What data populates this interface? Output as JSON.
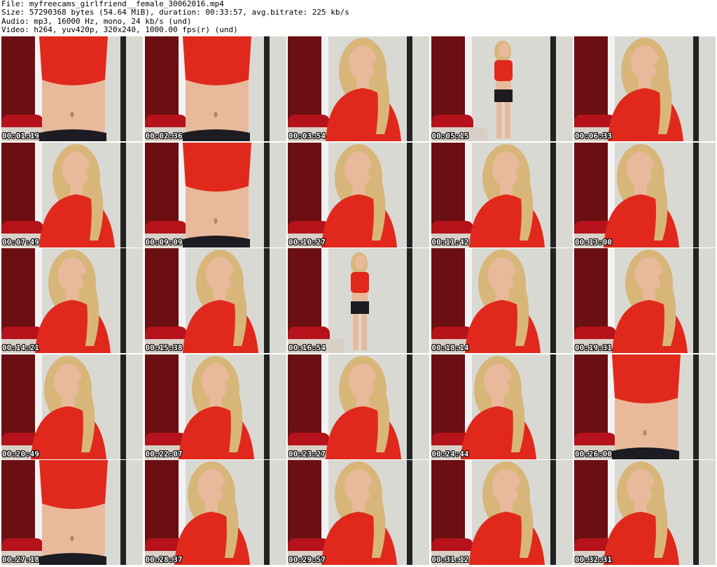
{
  "header": {
    "file_line": "File: myfreecams_girlfriend__female_30062016.mp4",
    "size_line": "Size: 57290368 bytes (54.64 MiB), duration: 00:33:57, avg.bitrate: 225 kb/s",
    "audio_line": "Audio: mp3, 16000 Hz, mono, 24 kb/s (und)",
    "video_line": "Video: h264, yuv420p, 320x240, 1000.00 fps(r) (und)"
  },
  "colors": {
    "top_red": "#e0291c",
    "wall": "#d9d9d4",
    "curtain": "#6b0f12",
    "hair": "#d8b67a",
    "skin": "#e8b99a",
    "shorts": "#1c1c22",
    "chair": "#b5121b",
    "floor": "#d8cfc6"
  },
  "thumbnails": [
    {
      "timestamp": "00:01:19",
      "scene": "torso"
    },
    {
      "timestamp": "00:02:36",
      "scene": "torso"
    },
    {
      "timestamp": "00:03:54",
      "scene": "portrait"
    },
    {
      "timestamp": "00:05:15",
      "scene": "standing"
    },
    {
      "timestamp": "00:06:33",
      "scene": "portrait"
    },
    {
      "timestamp": "00:07:49",
      "scene": "portrait"
    },
    {
      "timestamp": "00:09:09",
      "scene": "torso"
    },
    {
      "timestamp": "00:10:27",
      "scene": "portrait"
    },
    {
      "timestamp": "00:11:42",
      "scene": "portrait"
    },
    {
      "timestamp": "00:13:00",
      "scene": "portrait"
    },
    {
      "timestamp": "00:14:21",
      "scene": "portrait"
    },
    {
      "timestamp": "00:15:38",
      "scene": "portrait"
    },
    {
      "timestamp": "00:16:54",
      "scene": "standing"
    },
    {
      "timestamp": "00:18:14",
      "scene": "portrait"
    },
    {
      "timestamp": "00:19:31",
      "scene": "portrait"
    },
    {
      "timestamp": "00:20:49",
      "scene": "portrait"
    },
    {
      "timestamp": "00:22:07",
      "scene": "portrait"
    },
    {
      "timestamp": "00:23:27",
      "scene": "portrait"
    },
    {
      "timestamp": "00:24:44",
      "scene": "portrait"
    },
    {
      "timestamp": "00:26:00",
      "scene": "torso"
    },
    {
      "timestamp": "00:27:18",
      "scene": "torso"
    },
    {
      "timestamp": "00:28:37",
      "scene": "portrait"
    },
    {
      "timestamp": "00:29:57",
      "scene": "portrait"
    },
    {
      "timestamp": "00:31:12",
      "scene": "portrait"
    },
    {
      "timestamp": "00:32:31",
      "scene": "portrait"
    }
  ]
}
